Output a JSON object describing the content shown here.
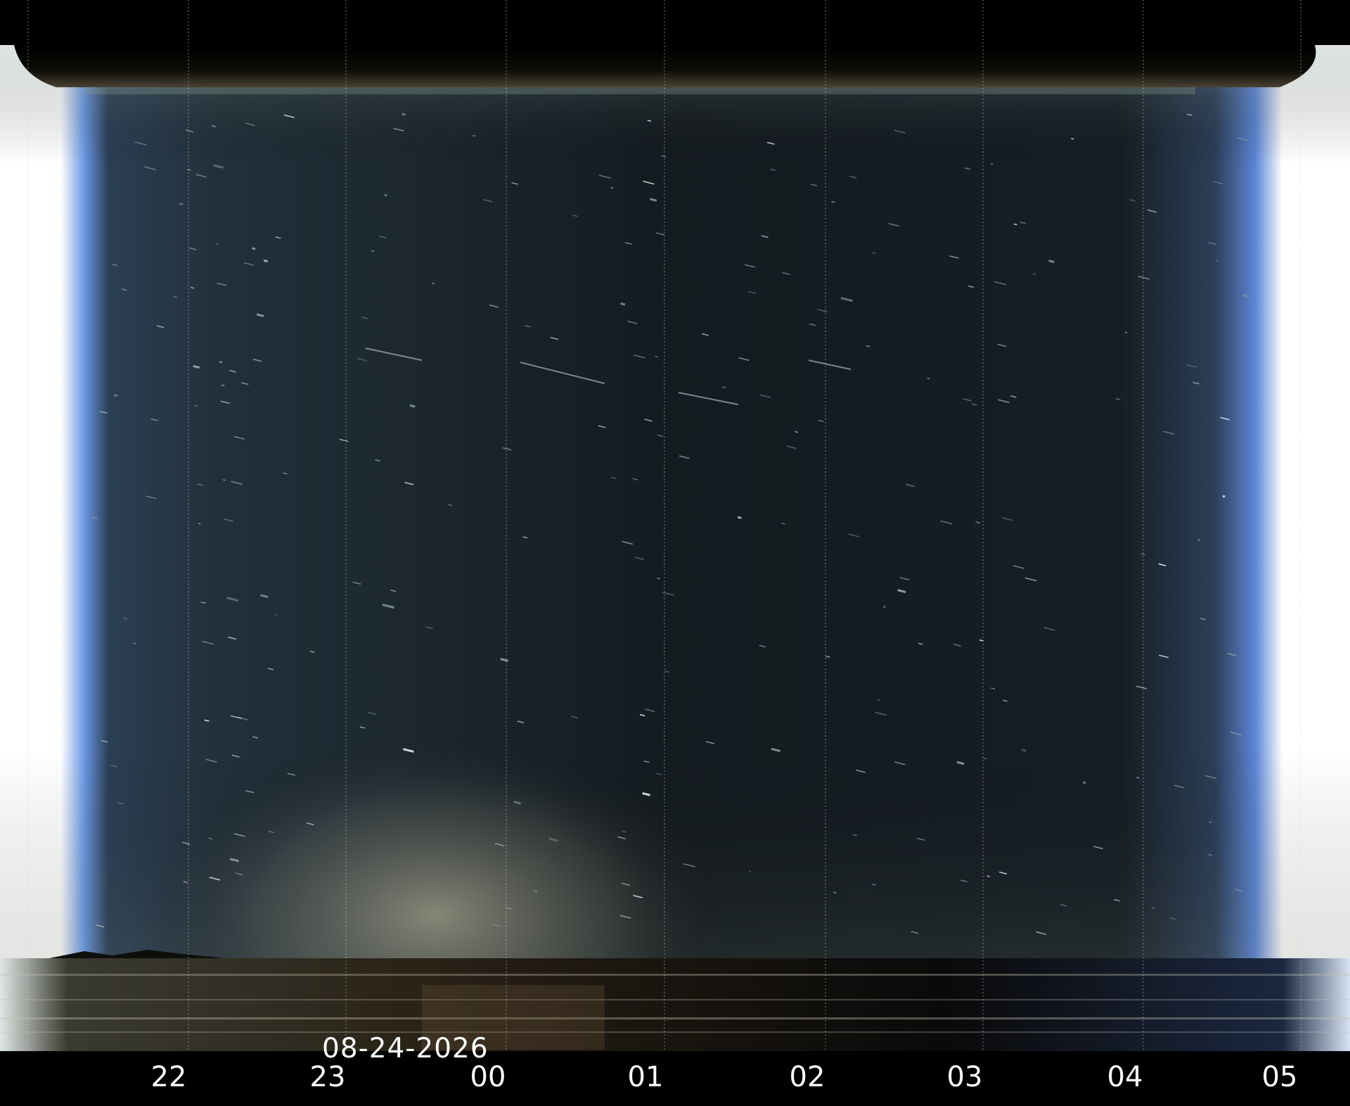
{
  "image": {
    "type": "keogram",
    "date": "08-24-2026",
    "hour_labels": [
      "22",
      "23",
      "00",
      "01",
      "02",
      "03",
      "04",
      "05"
    ],
    "colors": {
      "background": "#000000",
      "sky_dark": "#101619",
      "sky_mid": "#1f2b2f",
      "twilight_blue": "#5d86d6",
      "twilight_glow": "#ffffff",
      "horizon_glow": "#cfc8a8",
      "label_text": "#ffffff",
      "grid_line": "#cfcfcf"
    }
  }
}
